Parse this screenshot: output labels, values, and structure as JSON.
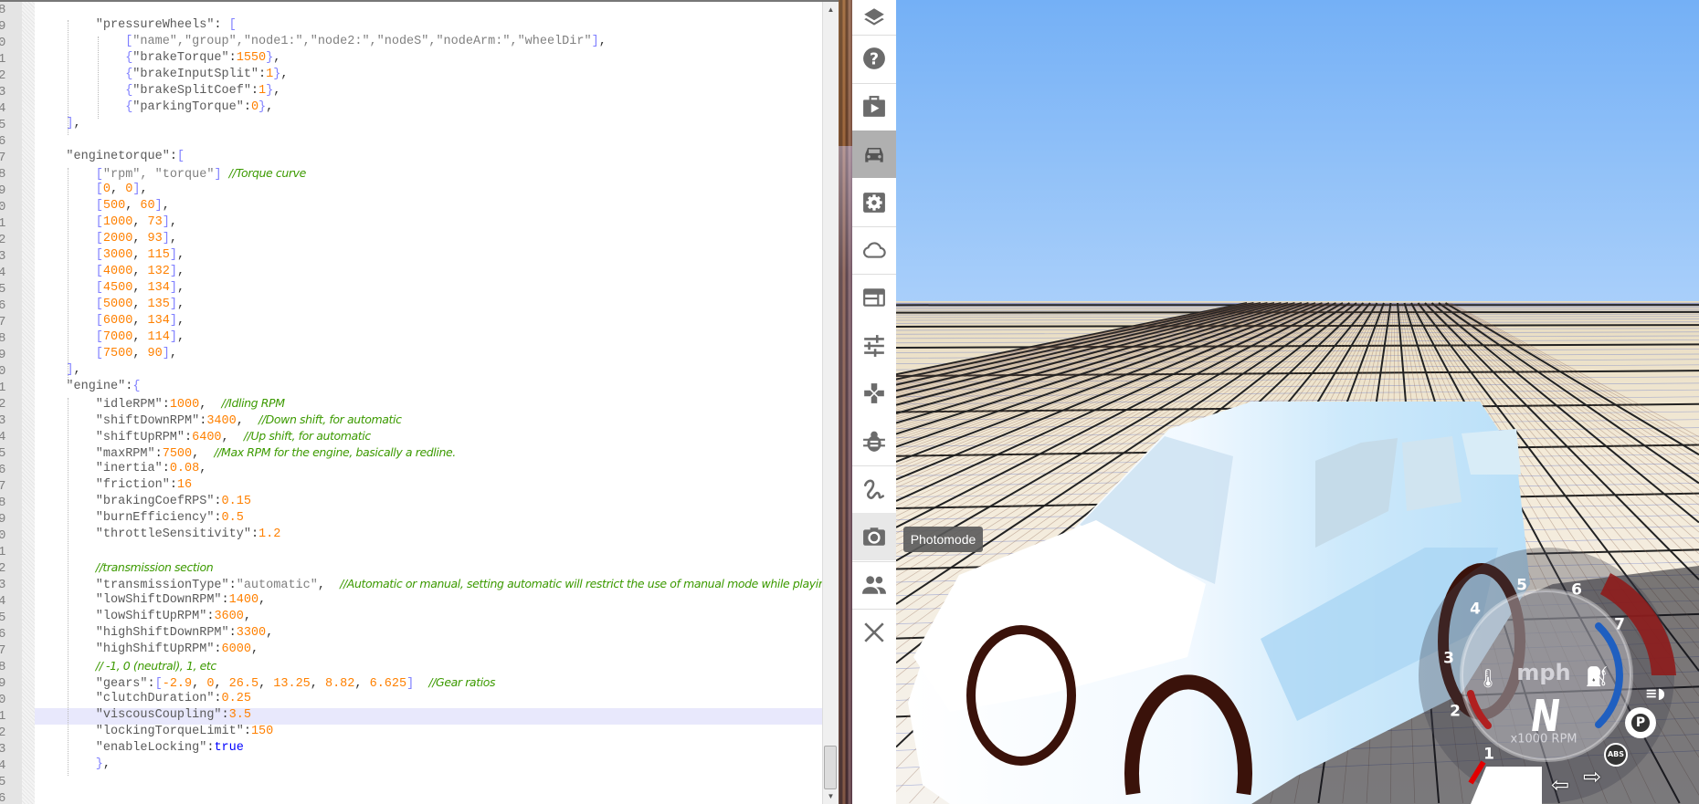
{
  "editor": {
    "highlighted_line_index": 43,
    "lines": [
      {
        "num": "8",
        "indent": 0,
        "tokens": []
      },
      {
        "num": "9",
        "indent": 2,
        "tokens": [
          [
            "k",
            "\"pressureWheels\""
          ],
          [
            "p",
            ": "
          ],
          [
            "b",
            "["
          ]
        ]
      },
      {
        "num": "0",
        "indent": 3,
        "tokens": [
          [
            "b",
            "["
          ],
          [
            "s",
            "\"name\",\"group\",\"node1:\",\"node2:\",\"nodeS\",\"nodeArm:\",\"wheelDir\""
          ],
          [
            "b",
            "]"
          ],
          [
            "p",
            ","
          ]
        ]
      },
      {
        "num": "1",
        "indent": 3,
        "tokens": [
          [
            "b",
            "{"
          ],
          [
            "k",
            "\"brakeTorque\""
          ],
          [
            "p",
            ":"
          ],
          [
            "n",
            "1550"
          ],
          [
            "b",
            "}"
          ],
          [
            "p",
            ","
          ]
        ]
      },
      {
        "num": "2",
        "indent": 3,
        "tokens": [
          [
            "b",
            "{"
          ],
          [
            "k",
            "\"brakeInputSplit\""
          ],
          [
            "p",
            ":"
          ],
          [
            "n",
            "1"
          ],
          [
            "b",
            "}"
          ],
          [
            "p",
            ","
          ]
        ]
      },
      {
        "num": "3",
        "indent": 3,
        "tokens": [
          [
            "b",
            "{"
          ],
          [
            "k",
            "\"brakeSplitCoef\""
          ],
          [
            "p",
            ":"
          ],
          [
            "n",
            "1"
          ],
          [
            "b",
            "}"
          ],
          [
            "p",
            ","
          ]
        ]
      },
      {
        "num": "4",
        "indent": 3,
        "tokens": [
          [
            "b",
            "{"
          ],
          [
            "k",
            "\"parkingTorque\""
          ],
          [
            "p",
            ":"
          ],
          [
            "n",
            "0"
          ],
          [
            "b",
            "}"
          ],
          [
            "p",
            ","
          ]
        ]
      },
      {
        "num": "5",
        "indent": 1,
        "tokens": [
          [
            "b",
            "]"
          ],
          [
            "p",
            ","
          ]
        ]
      },
      {
        "num": "6",
        "indent": 0,
        "tokens": []
      },
      {
        "num": "7",
        "indent": 1,
        "tokens": [
          [
            "k",
            "\"enginetorque\""
          ],
          [
            "p",
            ":"
          ],
          [
            "b",
            "["
          ]
        ]
      },
      {
        "num": "8",
        "indent": 2,
        "tokens": [
          [
            "b",
            "["
          ],
          [
            "s",
            "\"rpm\", \"torque\""
          ],
          [
            "b",
            "]"
          ],
          [
            "p",
            " "
          ],
          [
            "c",
            "//Torque curve"
          ]
        ]
      },
      {
        "num": "9",
        "indent": 2,
        "tokens": [
          [
            "b",
            "["
          ],
          [
            "n",
            "0"
          ],
          [
            "p",
            ", "
          ],
          [
            "n",
            "0"
          ],
          [
            "b",
            "]"
          ],
          [
            "p",
            ","
          ]
        ]
      },
      {
        "num": "0",
        "indent": 2,
        "tokens": [
          [
            "b",
            "["
          ],
          [
            "n",
            "500"
          ],
          [
            "p",
            ", "
          ],
          [
            "n",
            "60"
          ],
          [
            "b",
            "]"
          ],
          [
            "p",
            ","
          ]
        ]
      },
      {
        "num": "1",
        "indent": 2,
        "tokens": [
          [
            "b",
            "["
          ],
          [
            "n",
            "1000"
          ],
          [
            "p",
            ", "
          ],
          [
            "n",
            "73"
          ],
          [
            "b",
            "]"
          ],
          [
            "p",
            ","
          ]
        ]
      },
      {
        "num": "2",
        "indent": 2,
        "tokens": [
          [
            "b",
            "["
          ],
          [
            "n",
            "2000"
          ],
          [
            "p",
            ", "
          ],
          [
            "n",
            "93"
          ],
          [
            "b",
            "]"
          ],
          [
            "p",
            ","
          ]
        ]
      },
      {
        "num": "3",
        "indent": 2,
        "tokens": [
          [
            "b",
            "["
          ],
          [
            "n",
            "3000"
          ],
          [
            "p",
            ", "
          ],
          [
            "n",
            "115"
          ],
          [
            "b",
            "]"
          ],
          [
            "p",
            ","
          ]
        ]
      },
      {
        "num": "4",
        "indent": 2,
        "tokens": [
          [
            "b",
            "["
          ],
          [
            "n",
            "4000"
          ],
          [
            "p",
            ", "
          ],
          [
            "n",
            "132"
          ],
          [
            "b",
            "]"
          ],
          [
            "p",
            ","
          ]
        ]
      },
      {
        "num": "5",
        "indent": 2,
        "tokens": [
          [
            "b",
            "["
          ],
          [
            "n",
            "4500"
          ],
          [
            "p",
            ", "
          ],
          [
            "n",
            "134"
          ],
          [
            "b",
            "]"
          ],
          [
            "p",
            ","
          ]
        ]
      },
      {
        "num": "6",
        "indent": 2,
        "tokens": [
          [
            "b",
            "["
          ],
          [
            "n",
            "5000"
          ],
          [
            "p",
            ", "
          ],
          [
            "n",
            "135"
          ],
          [
            "b",
            "]"
          ],
          [
            "p",
            ","
          ]
        ]
      },
      {
        "num": "7",
        "indent": 2,
        "tokens": [
          [
            "b",
            "["
          ],
          [
            "n",
            "6000"
          ],
          [
            "p",
            ", "
          ],
          [
            "n",
            "134"
          ],
          [
            "b",
            "]"
          ],
          [
            "p",
            ","
          ]
        ]
      },
      {
        "num": "8",
        "indent": 2,
        "tokens": [
          [
            "b",
            "["
          ],
          [
            "n",
            "7000"
          ],
          [
            "p",
            ", "
          ],
          [
            "n",
            "114"
          ],
          [
            "b",
            "]"
          ],
          [
            "p",
            ","
          ]
        ]
      },
      {
        "num": "9",
        "indent": 2,
        "tokens": [
          [
            "b",
            "["
          ],
          [
            "n",
            "7500"
          ],
          [
            "p",
            ", "
          ],
          [
            "n",
            "90"
          ],
          [
            "b",
            "]"
          ],
          [
            "p",
            ","
          ]
        ]
      },
      {
        "num": "0",
        "indent": 1,
        "tokens": [
          [
            "b",
            "]"
          ],
          [
            "p",
            ","
          ]
        ]
      },
      {
        "num": "1",
        "indent": 1,
        "tokens": [
          [
            "k",
            "\"engine\""
          ],
          [
            "p",
            ":"
          ],
          [
            "b",
            "{"
          ]
        ]
      },
      {
        "num": "2",
        "indent": 2,
        "tokens": [
          [
            "k",
            "\"idleRPM\""
          ],
          [
            "p",
            ":"
          ],
          [
            "n",
            "1000"
          ],
          [
            "p",
            ",  "
          ],
          [
            "c",
            "//Idling RPM"
          ]
        ]
      },
      {
        "num": "3",
        "indent": 2,
        "tokens": [
          [
            "k",
            "\"shiftDownRPM\""
          ],
          [
            "p",
            ":"
          ],
          [
            "n",
            "3400"
          ],
          [
            "p",
            ",  "
          ],
          [
            "c",
            "//Down shift, for automatic"
          ]
        ]
      },
      {
        "num": "4",
        "indent": 2,
        "tokens": [
          [
            "k",
            "\"shiftUpRPM\""
          ],
          [
            "p",
            ":"
          ],
          [
            "n",
            "6400"
          ],
          [
            "p",
            ",  "
          ],
          [
            "c",
            "//Up shift, for automatic"
          ]
        ]
      },
      {
        "num": "5",
        "indent": 2,
        "tokens": [
          [
            "k",
            "\"maxRPM\""
          ],
          [
            "p",
            ":"
          ],
          [
            "n",
            "7500"
          ],
          [
            "p",
            ",  "
          ],
          [
            "c",
            "//Max RPM for the engine, basically a redline."
          ]
        ]
      },
      {
        "num": "6",
        "indent": 2,
        "tokens": [
          [
            "k",
            "\"inertia\""
          ],
          [
            "p",
            ":"
          ],
          [
            "n",
            "0.08"
          ],
          [
            "p",
            ","
          ]
        ]
      },
      {
        "num": "7",
        "indent": 2,
        "tokens": [
          [
            "k",
            "\"friction\""
          ],
          [
            "p",
            ":"
          ],
          [
            "n",
            "16"
          ]
        ]
      },
      {
        "num": "8",
        "indent": 2,
        "tokens": [
          [
            "k",
            "\"brakingCoefRPS\""
          ],
          [
            "p",
            ":"
          ],
          [
            "n",
            "0.15"
          ]
        ]
      },
      {
        "num": "9",
        "indent": 2,
        "tokens": [
          [
            "k",
            "\"burnEfficiency\""
          ],
          [
            "p",
            ":"
          ],
          [
            "n",
            "0.5"
          ]
        ]
      },
      {
        "num": "0",
        "indent": 2,
        "tokens": [
          [
            "k",
            "\"throttleSensitivity\""
          ],
          [
            "p",
            ":"
          ],
          [
            "n",
            "1.2"
          ]
        ]
      },
      {
        "num": "1",
        "indent": 0,
        "tokens": []
      },
      {
        "num": "2",
        "indent": 2,
        "tokens": [
          [
            "c",
            "//transmission section"
          ]
        ]
      },
      {
        "num": "3",
        "indent": 2,
        "tokens": [
          [
            "k",
            "\"transmissionType\""
          ],
          [
            "p",
            ":"
          ],
          [
            "s",
            "\"automatic\""
          ],
          [
            "p",
            ",  "
          ],
          [
            "c",
            "//Automatic or manual, setting automatic will restrict the use of manual mode while playing"
          ]
        ]
      },
      {
        "num": "4",
        "indent": 2,
        "tokens": [
          [
            "k",
            "\"lowShiftDownRPM\""
          ],
          [
            "p",
            ":"
          ],
          [
            "n",
            "1400"
          ],
          [
            "p",
            ","
          ]
        ]
      },
      {
        "num": "5",
        "indent": 2,
        "tokens": [
          [
            "k",
            "\"lowShiftUpRPM\""
          ],
          [
            "p",
            ":"
          ],
          [
            "n",
            "3600"
          ],
          [
            "p",
            ","
          ]
        ]
      },
      {
        "num": "6",
        "indent": 2,
        "tokens": [
          [
            "k",
            "\"highShiftDownRPM\""
          ],
          [
            "p",
            ":"
          ],
          [
            "n",
            "3300"
          ],
          [
            "p",
            ","
          ]
        ]
      },
      {
        "num": "7",
        "indent": 2,
        "tokens": [
          [
            "k",
            "\"highShiftUpRPM\""
          ],
          [
            "p",
            ":"
          ],
          [
            "n",
            "6000"
          ],
          [
            "p",
            ","
          ]
        ]
      },
      {
        "num": "8",
        "indent": 2,
        "tokens": [
          [
            "c",
            "// -1, 0 (neutral), 1, etc"
          ]
        ]
      },
      {
        "num": "9",
        "indent": 2,
        "tokens": [
          [
            "k",
            "\"gears\""
          ],
          [
            "p",
            ":"
          ],
          [
            "b",
            "["
          ],
          [
            "n",
            "-2.9"
          ],
          [
            "p",
            ", "
          ],
          [
            "n",
            "0"
          ],
          [
            "p",
            ", "
          ],
          [
            "n",
            "26.5"
          ],
          [
            "p",
            ", "
          ],
          [
            "n",
            "13.25"
          ],
          [
            "p",
            ", "
          ],
          [
            "n",
            "8.82"
          ],
          [
            "p",
            ", "
          ],
          [
            "n",
            "6.625"
          ],
          [
            "b",
            "]"
          ],
          [
            "p",
            "  "
          ],
          [
            "c",
            "//Gear ratios"
          ]
        ]
      },
      {
        "num": "0",
        "indent": 2,
        "tokens": [
          [
            "k",
            "\"clutchDuration\""
          ],
          [
            "p",
            ":"
          ],
          [
            "n",
            "0.25"
          ]
        ]
      },
      {
        "num": "1",
        "indent": 2,
        "tokens": [
          [
            "k",
            "\"viscousCoupling\""
          ],
          [
            "p",
            ":"
          ],
          [
            "n",
            "3.5"
          ]
        ]
      },
      {
        "num": "2",
        "indent": 2,
        "tokens": [
          [
            "k",
            "\"lockingTorqueLimit\""
          ],
          [
            "p",
            ":"
          ],
          [
            "n",
            "150"
          ]
        ]
      },
      {
        "num": "3",
        "indent": 2,
        "tokens": [
          [
            "k",
            "\"enableLocking\""
          ],
          [
            "p",
            ":"
          ],
          [
            "kw",
            "true"
          ]
        ]
      },
      {
        "num": "4",
        "indent": 2,
        "tokens": [
          [
            "b",
            "}"
          ],
          [
            "p",
            ","
          ]
        ]
      },
      {
        "num": "5",
        "indent": 0,
        "tokens": []
      },
      {
        "num": "6",
        "indent": 0,
        "tokens": []
      }
    ]
  },
  "sidebar": {
    "items": [
      {
        "icon": "layers-icon",
        "active": false
      },
      {
        "icon": "help-icon",
        "active": false
      },
      {
        "icon": "scenario-play-icon",
        "active": false
      },
      {
        "icon": "vehicle-car-icon",
        "active": true
      },
      {
        "icon": "vehicle-config-gear-icon",
        "active": false
      },
      {
        "icon": "cloud-icon",
        "active": false
      },
      {
        "icon": "apps-window-icon",
        "active": false
      },
      {
        "icon": "options-sliders-icon",
        "active": false
      },
      {
        "icon": "controls-gamepad-icon",
        "active": false
      },
      {
        "icon": "debug-bug-icon",
        "active": false
      },
      {
        "icon": "track-builder-squiggle-icon",
        "active": false
      },
      {
        "icon": "photomode-camera-icon",
        "active": false,
        "hover": true
      },
      {
        "icon": "multiplayer-people-icon",
        "active": false
      },
      {
        "icon": "close-icon",
        "active": false
      }
    ],
    "tooltip": "Photomode"
  },
  "hud": {
    "rpm_marks": [
      "1",
      "2",
      "3",
      "4",
      "5",
      "6",
      "7"
    ],
    "speed_unit": "mph",
    "gear": "N",
    "rpm_unit": "x1000 RPM",
    "parking_brake": "P",
    "abs": "ABS"
  },
  "colors": {
    "sky_top": "#74b0f6",
    "sky_horizon": "#a9cffa",
    "ground": "#efe6d2",
    "redline": "#8e1c1c",
    "fuel_arc": "#1f5fc0",
    "temp_arc": "#b02020"
  }
}
